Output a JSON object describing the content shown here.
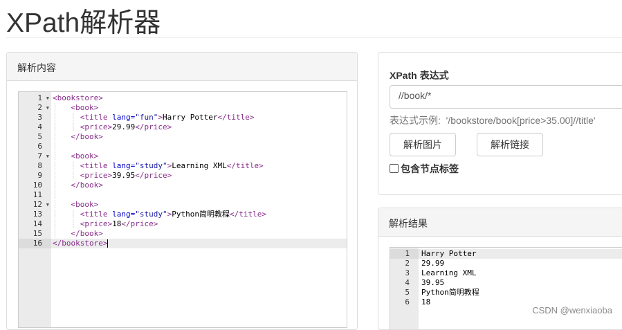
{
  "page": {
    "title": "XPath解析器"
  },
  "left_panel": {
    "heading": "解析内容",
    "lines": [
      {
        "n": "1",
        "fold": true
      },
      {
        "n": "2",
        "fold": true
      },
      {
        "n": "3",
        "fold": false
      },
      {
        "n": "4",
        "fold": false
      },
      {
        "n": "5",
        "fold": false
      },
      {
        "n": "6",
        "fold": false
      },
      {
        "n": "7",
        "fold": true
      },
      {
        "n": "8",
        "fold": false
      },
      {
        "n": "9",
        "fold": false
      },
      {
        "n": "10",
        "fold": false
      },
      {
        "n": "11",
        "fold": false
      },
      {
        "n": "12",
        "fold": true
      },
      {
        "n": "13",
        "fold": false
      },
      {
        "n": "14",
        "fold": false
      },
      {
        "n": "15",
        "fold": false
      },
      {
        "n": "16",
        "fold": false
      }
    ],
    "code": {
      "l1": "<bookstore>",
      "l2": "<book>",
      "l3_open": "<title ",
      "l3_attr": "lang=",
      "l3_val": "\"fun\"",
      "l3_gt": ">",
      "l3_text": "Harry Potter",
      "l3_close": "</title>",
      "l4_open": "<price>",
      "l4_text": "29.99",
      "l4_close": "</price>",
      "l5": "</book>",
      "l7": "<book>",
      "l8_open": "<title ",
      "l8_attr": "lang=",
      "l8_val": "\"study\"",
      "l8_gt": ">",
      "l8_text": "Learning XML",
      "l8_close": "</title>",
      "l9_open": "<price>",
      "l9_text": "39.95",
      "l9_close": "</price>",
      "l10": "</book>",
      "l12": "<book>",
      "l13_open": "<title ",
      "l13_attr": "lang=",
      "l13_val": "\"study\"",
      "l13_gt": ">",
      "l13_text": "Python简明教程",
      "l13_close": "</title>",
      "l14_open": "<price>",
      "l14_text": "18",
      "l14_close": "</price>",
      "l15": "</book>",
      "l16": "</bookstore>"
    }
  },
  "query_panel": {
    "label": "XPath 表达式",
    "input_value": "//book/*",
    "example_label": "表达式示例:",
    "example_value": "'/bookstore/book[price>35.00]//title'",
    "btn_image": "解析图片",
    "btn_link": "解析链接",
    "include_tags": "包含节点标签",
    "include_tags_checked": false
  },
  "result_panel": {
    "heading": "解析结果",
    "rows": [
      {
        "n": "1",
        "text": "Harry Potter"
      },
      {
        "n": "2",
        "text": "29.99"
      },
      {
        "n": "3",
        "text": "Learning XML"
      },
      {
        "n": "4",
        "text": "39.95"
      },
      {
        "n": "5",
        "text": "Python简明教程"
      },
      {
        "n": "6",
        "text": "18"
      }
    ]
  },
  "watermark": "CSDN @wenxiaoba"
}
